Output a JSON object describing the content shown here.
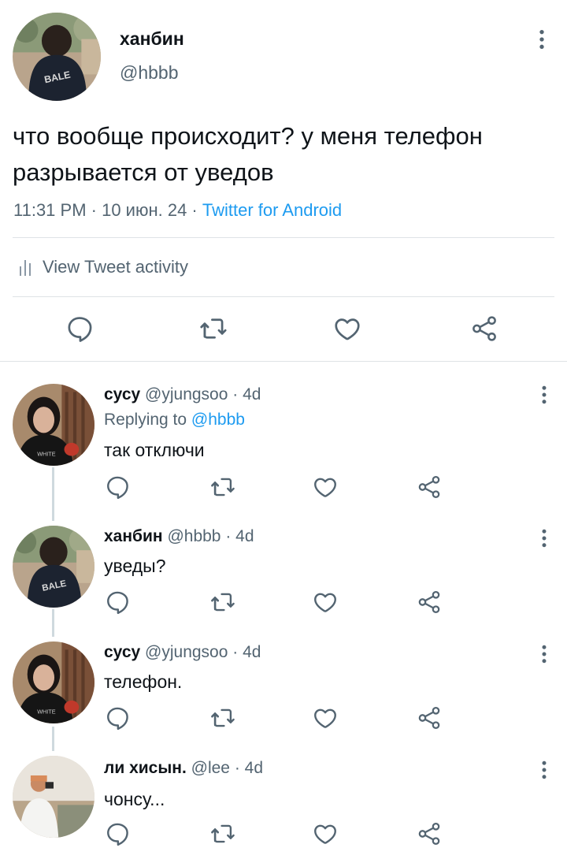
{
  "main_tweet": {
    "name": "ханбин",
    "handle": "@hbbb",
    "text": "что вообще происходит? у меня телефон разрывается от уведов",
    "time": "11:31 PM · 10 июн. 24 · ",
    "source": "Twitter for Android",
    "activity_label": "View Tweet activity"
  },
  "replies": [
    {
      "name": "сусу",
      "handle_time": " @yjungsoo · 4d",
      "replying_prefix": "Replying to ",
      "replying_to": "@hbbb",
      "text": "так отключи"
    },
    {
      "name": "ханбин",
      "handle_time": " @hbbb · 4d",
      "text": "уведы?"
    },
    {
      "name": "сусу",
      "handle_time": " @yjungsoo · 4d",
      "text": "телефон."
    },
    {
      "name": "ли хисын.",
      "handle_time": " @lee · 4d",
      "text": "чонсу..."
    }
  ],
  "icons": {
    "reply": "comment-icon",
    "retweet": "retweet-icon",
    "like": "heart-icon",
    "share": "share-icon",
    "more": "more-vertical-icon",
    "activity": "bar-chart-icon"
  },
  "colors": {
    "accent": "#1d9bf0",
    "secondary_text": "#536471",
    "divider": "#dfe3e6"
  }
}
